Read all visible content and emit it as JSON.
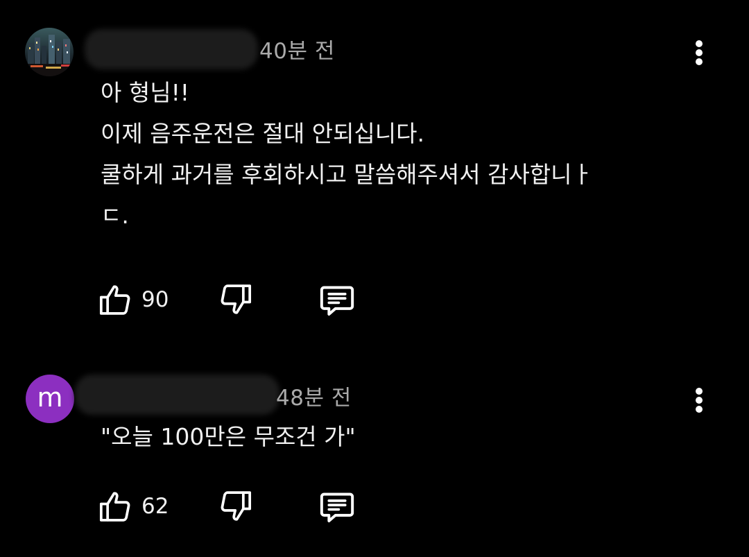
{
  "comments": [
    {
      "timestamp": "40분 전",
      "avatar_letter": "",
      "lines": [
        "아 형님!!",
        "이제 음주운전은 절대 안되십니다.",
        "쿨하게 과거를 후회하시고 말씀해주셔서 감사합니ㅏ",
        "ㄷ."
      ],
      "likes": "90"
    },
    {
      "timestamp": "48분 전",
      "avatar_letter": "m",
      "lines": [
        "\"오늘 100만은 무조건 가\""
      ],
      "likes": "62"
    }
  ],
  "icons": {
    "like": "thumb-up-icon",
    "dislike": "thumb-down-icon",
    "reply": "reply-icon",
    "more": "more-vert-icon"
  },
  "colors": {
    "background": "#000000",
    "text": "#f1f1f1",
    "secondary_text": "#aaaaaa",
    "avatar_m": "#8c2fc0"
  }
}
